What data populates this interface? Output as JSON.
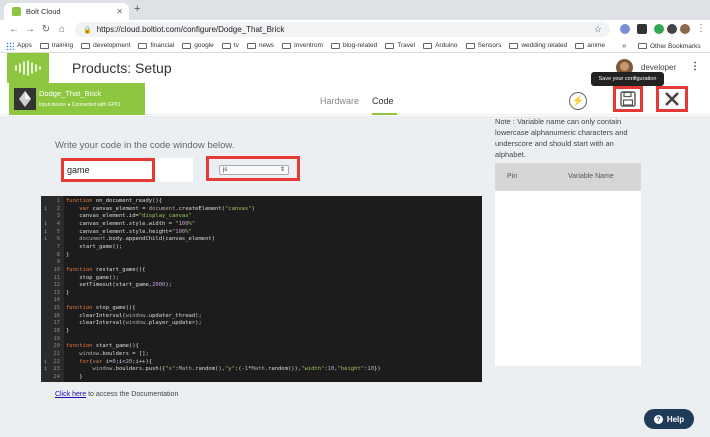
{
  "browser": {
    "tab_title": "Bolt Cloud",
    "url": "https://cloud.boltiot.com/configure/Dodge_That_Brick",
    "bookmarks": [
      "Apps",
      "training",
      "development",
      "financial",
      "google",
      "tv",
      "news",
      "Inventrom",
      "blog-related",
      "Travel",
      "Arduino",
      "Sensors",
      "wedding related",
      "anime"
    ],
    "other_bookmarks": "Other Bookmarks",
    "more": "»"
  },
  "header": {
    "title": "Products: Setup",
    "user": "developer"
  },
  "device": {
    "name": "Dodge_That_Brick",
    "status": "Input device ● Connected with GPIO"
  },
  "tabs": {
    "hardware": "Hardware",
    "code": "Code",
    "active": "Code"
  },
  "toolbar": {
    "save_tooltip": "Save your configuration"
  },
  "editor": {
    "instruction": "Write your code in the code window below.",
    "file_name": "game",
    "language": "js",
    "lines": [
      {
        "n": "1",
        "info": false,
        "code": "function on_document_ready(){"
      },
      {
        "n": "2",
        "info": true,
        "code": "    var canvas_element = document.createElement(\"canvas\")"
      },
      {
        "n": "3",
        "info": false,
        "code": "    canvas_element.id=\"display_canvas\""
      },
      {
        "n": "4",
        "info": true,
        "code": "    canvas_element.style.width = \"100%\""
      },
      {
        "n": "5",
        "info": true,
        "code": "    canvas_element.style.height=\"100%\""
      },
      {
        "n": "6",
        "info": true,
        "code": "    document.body.appendChild(canvas_element)"
      },
      {
        "n": "7",
        "info": false,
        "code": "    start_game();"
      },
      {
        "n": "8",
        "info": false,
        "code": "}"
      },
      {
        "n": "9",
        "info": false,
        "code": ""
      },
      {
        "n": "10",
        "info": false,
        "code": "function restart_game(){"
      },
      {
        "n": "11",
        "info": false,
        "code": "    stop_game();"
      },
      {
        "n": "12",
        "info": false,
        "code": "    setTimeout(start_game,2000);"
      },
      {
        "n": "13",
        "info": false,
        "code": "}"
      },
      {
        "n": "14",
        "info": false,
        "code": ""
      },
      {
        "n": "15",
        "info": false,
        "code": "function stop_game(){"
      },
      {
        "n": "16",
        "info": false,
        "code": "    clearInterval(window.updater_thread);"
      },
      {
        "n": "17",
        "info": false,
        "code": "    clearInterval(window.player_updater);"
      },
      {
        "n": "18",
        "info": false,
        "code": "}"
      },
      {
        "n": "19",
        "info": false,
        "code": ""
      },
      {
        "n": "20",
        "info": false,
        "code": "function start_game(){"
      },
      {
        "n": "21",
        "info": false,
        "code": "    window.boulders = [];"
      },
      {
        "n": "22",
        "info": true,
        "code": "    for(var i=0;i<20;i++){"
      },
      {
        "n": "23",
        "info": true,
        "code": "        window.boulders.push({\"x\":Math.random(),\"y\":(-1*Math.random()),\"width\":10,\"height\":10})"
      },
      {
        "n": "24",
        "info": false,
        "code": "    }"
      }
    ],
    "doc_link": "Click here",
    "doc_text": " to access the Documentation"
  },
  "variables": {
    "note": "Note : Variable name can only contain lowercase alphanumeric characters and underscore and should start with an alphabet.",
    "col_pin": "Pin",
    "col_name": "Variable Name"
  },
  "help": {
    "label": "Help"
  },
  "colors": {
    "brand": "#8dc63f",
    "highlight": "#e53935",
    "help": "#1f3b57"
  }
}
